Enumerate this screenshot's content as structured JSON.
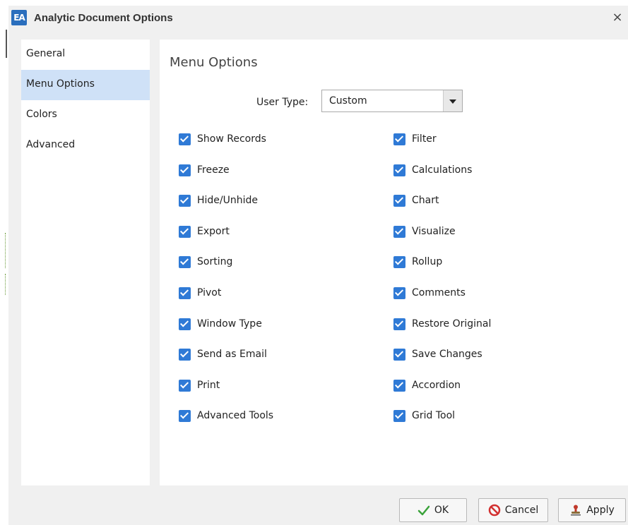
{
  "window": {
    "icon_text": "EA",
    "title": "Analytic Document Options",
    "close_glyph": "×"
  },
  "sidebar": {
    "items": [
      {
        "label": "General",
        "active": false
      },
      {
        "label": "Menu Options",
        "active": true
      },
      {
        "label": "Colors",
        "active": false
      },
      {
        "label": "Advanced",
        "active": false
      }
    ]
  },
  "main": {
    "title": "Menu Options",
    "user_type_label": "User Type:",
    "user_type_value": "Custom",
    "left_options": [
      {
        "label": "Show Records",
        "checked": true
      },
      {
        "label": "Freeze",
        "checked": true
      },
      {
        "label": "Hide/Unhide",
        "checked": true
      },
      {
        "label": "Export",
        "checked": true
      },
      {
        "label": "Sorting",
        "checked": true
      },
      {
        "label": "Pivot",
        "checked": true
      },
      {
        "label": "Window Type",
        "checked": true
      },
      {
        "label": "Send as Email",
        "checked": true
      },
      {
        "label": "Print",
        "checked": true
      },
      {
        "label": "Advanced Tools",
        "checked": true
      }
    ],
    "right_options": [
      {
        "label": "Filter",
        "checked": true
      },
      {
        "label": "Calculations",
        "checked": true
      },
      {
        "label": "Chart",
        "checked": true
      },
      {
        "label": "Visualize",
        "checked": true
      },
      {
        "label": "Rollup",
        "checked": true
      },
      {
        "label": "Comments",
        "checked": true
      },
      {
        "label": "Restore Original",
        "checked": true
      },
      {
        "label": "Save Changes",
        "checked": true
      },
      {
        "label": "Accordion",
        "checked": true
      },
      {
        "label": "Grid Tool",
        "checked": true
      }
    ]
  },
  "footer": {
    "ok_label": "OK",
    "cancel_label": "Cancel",
    "apply_label": "Apply"
  },
  "colors": {
    "accent": "#2f7ad6",
    "selected_nav": "#cfe1f7",
    "dialog_bg": "#f0f0f0"
  }
}
